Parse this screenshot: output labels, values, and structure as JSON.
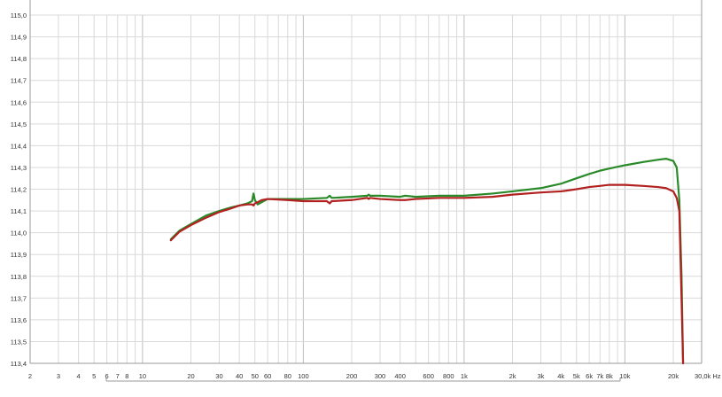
{
  "chart_data": {
    "type": "line",
    "x_scale": "log",
    "xlim": [
      2,
      30000
    ],
    "ylim": [
      113.4,
      115.0
    ],
    "grid": true,
    "x_ticks": [
      {
        "value": 2,
        "label": "2"
      },
      {
        "value": 3,
        "label": "3"
      },
      {
        "value": 4,
        "label": "4"
      },
      {
        "value": 5,
        "label": "5"
      },
      {
        "value": 6,
        "label": "6"
      },
      {
        "value": 7,
        "label": "7"
      },
      {
        "value": 8,
        "label": "8"
      },
      {
        "value": 10,
        "label": "10"
      },
      {
        "value": 20,
        "label": "20"
      },
      {
        "value": 30,
        "label": "30"
      },
      {
        "value": 40,
        "label": "40"
      },
      {
        "value": 50,
        "label": "50"
      },
      {
        "value": 60,
        "label": "60"
      },
      {
        "value": 80,
        "label": "80"
      },
      {
        "value": 100,
        "label": "100"
      },
      {
        "value": 200,
        "label": "200"
      },
      {
        "value": 300,
        "label": "300"
      },
      {
        "value": 400,
        "label": "400"
      },
      {
        "value": 600,
        "label": "600"
      },
      {
        "value": 800,
        "label": "800"
      },
      {
        "value": 1000,
        "label": "1k"
      },
      {
        "value": 2000,
        "label": "2k"
      },
      {
        "value": 3000,
        "label": "3k"
      },
      {
        "value": 4000,
        "label": "4k"
      },
      {
        "value": 5000,
        "label": "5k"
      },
      {
        "value": 6000,
        "label": "6k"
      },
      {
        "value": 7000,
        "label": "7k"
      },
      {
        "value": 8000,
        "label": "8k"
      },
      {
        "value": 10000,
        "label": "10k"
      },
      {
        "value": 20000,
        "label": "20k"
      },
      {
        "value": 30000,
        "label": "30,0k Hz"
      }
    ],
    "y_ticks": [
      {
        "value": 113.4,
        "label": "113,4"
      },
      {
        "value": 113.5,
        "label": "113,5"
      },
      {
        "value": 113.6,
        "label": "113,6"
      },
      {
        "value": 113.7,
        "label": "113,7"
      },
      {
        "value": 113.8,
        "label": "113,8"
      },
      {
        "value": 113.9,
        "label": "113,9"
      },
      {
        "value": 114.0,
        "label": "114,0"
      },
      {
        "value": 114.1,
        "label": "114,1"
      },
      {
        "value": 114.2,
        "label": "114,2"
      },
      {
        "value": 114.3,
        "label": "114,3"
      },
      {
        "value": 114.4,
        "label": "114,4"
      },
      {
        "value": 114.5,
        "label": "114,5"
      },
      {
        "value": 114.6,
        "label": "114,6"
      },
      {
        "value": 114.7,
        "label": "114,7"
      },
      {
        "value": 114.8,
        "label": "114,8"
      },
      {
        "value": 114.9,
        "label": "114,9"
      },
      {
        "value": 115.0,
        "label": "115,0"
      }
    ],
    "series": [
      {
        "color": "#2a8a2a",
        "points": [
          [
            15,
            113.97
          ],
          [
            17,
            114.01
          ],
          [
            20,
            114.04
          ],
          [
            25,
            114.08
          ],
          [
            30,
            114.1
          ],
          [
            35,
            114.115
          ],
          [
            40,
            114.125
          ],
          [
            45,
            114.135
          ],
          [
            48,
            114.145
          ],
          [
            49,
            114.18
          ],
          [
            50,
            114.15
          ],
          [
            52,
            114.13
          ],
          [
            55,
            114.14
          ],
          [
            60,
            114.155
          ],
          [
            80,
            114.155
          ],
          [
            100,
            114.155
          ],
          [
            140,
            114.16
          ],
          [
            146,
            114.17
          ],
          [
            150,
            114.16
          ],
          [
            200,
            114.165
          ],
          [
            250,
            114.17
          ],
          [
            255,
            114.175
          ],
          [
            260,
            114.17
          ],
          [
            300,
            114.17
          ],
          [
            400,
            114.165
          ],
          [
            430,
            114.17
          ],
          [
            500,
            114.165
          ],
          [
            700,
            114.17
          ],
          [
            1000,
            114.17
          ],
          [
            1500,
            114.18
          ],
          [
            2000,
            114.19
          ],
          [
            3000,
            114.205
          ],
          [
            4000,
            114.225
          ],
          [
            5000,
            114.25
          ],
          [
            6000,
            114.27
          ],
          [
            7000,
            114.285
          ],
          [
            8000,
            114.295
          ],
          [
            10000,
            114.31
          ],
          [
            13000,
            114.325
          ],
          [
            16000,
            114.335
          ],
          [
            18000,
            114.34
          ],
          [
            20000,
            114.33
          ],
          [
            21000,
            114.3
          ],
          [
            21800,
            114.15
          ],
          [
            22500,
            113.8
          ],
          [
            23000,
            113.4
          ]
        ]
      },
      {
        "color": "#b22020",
        "points": [
          [
            15,
            113.965
          ],
          [
            17,
            114.005
          ],
          [
            20,
            114.035
          ],
          [
            25,
            114.07
          ],
          [
            30,
            114.095
          ],
          [
            35,
            114.11
          ],
          [
            40,
            114.125
          ],
          [
            45,
            114.13
          ],
          [
            48,
            114.13
          ],
          [
            49,
            114.125
          ],
          [
            50,
            114.135
          ],
          [
            52,
            114.14
          ],
          [
            55,
            114.15
          ],
          [
            60,
            114.155
          ],
          [
            80,
            114.15
          ],
          [
            100,
            114.145
          ],
          [
            140,
            114.145
          ],
          [
            146,
            114.135
          ],
          [
            150,
            114.145
          ],
          [
            200,
            114.15
          ],
          [
            250,
            114.16
          ],
          [
            255,
            114.155
          ],
          [
            260,
            114.16
          ],
          [
            300,
            114.155
          ],
          [
            400,
            114.15
          ],
          [
            430,
            114.15
          ],
          [
            500,
            114.155
          ],
          [
            700,
            114.16
          ],
          [
            1000,
            114.16
          ],
          [
            1500,
            114.165
          ],
          [
            2000,
            114.175
          ],
          [
            3000,
            114.185
          ],
          [
            4000,
            114.19
          ],
          [
            5000,
            114.2
          ],
          [
            6000,
            114.21
          ],
          [
            7000,
            114.215
          ],
          [
            8000,
            114.22
          ],
          [
            10000,
            114.22
          ],
          [
            13000,
            114.215
          ],
          [
            16000,
            114.21
          ],
          [
            18000,
            114.205
          ],
          [
            20000,
            114.19
          ],
          [
            21000,
            114.16
          ],
          [
            21800,
            114.1
          ],
          [
            22500,
            113.7
          ],
          [
            23000,
            113.4
          ]
        ]
      }
    ]
  }
}
